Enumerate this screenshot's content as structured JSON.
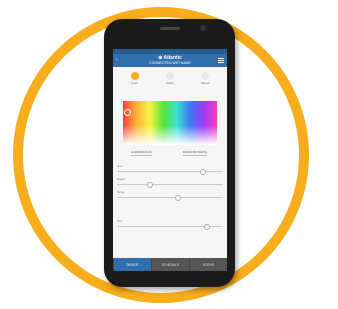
{
  "app": {
    "status_right": "",
    "brand": "⊕ Atlantic",
    "device_title": "CONNECTED WIFI NAME"
  },
  "modes": [
    {
      "label": "Color"
    },
    {
      "label": "White"
    },
    {
      "label": "Scene"
    }
  ],
  "picker": {
    "left_label": "HARMONIOUS",
    "right_label": "RANDOM WHITE"
  },
  "sliders": [
    {
      "label": "Hue",
      "value": 0.78
    },
    {
      "label": "Bright",
      "value": 0.28
    },
    {
      "label": "Temp",
      "value": 0.55
    },
    {
      "label": "Dim",
      "value": 0.82
    }
  ],
  "tabs": [
    {
      "label": "DEVICE"
    },
    {
      "label": "SCHEDULE"
    },
    {
      "label": "SCENE"
    }
  ]
}
